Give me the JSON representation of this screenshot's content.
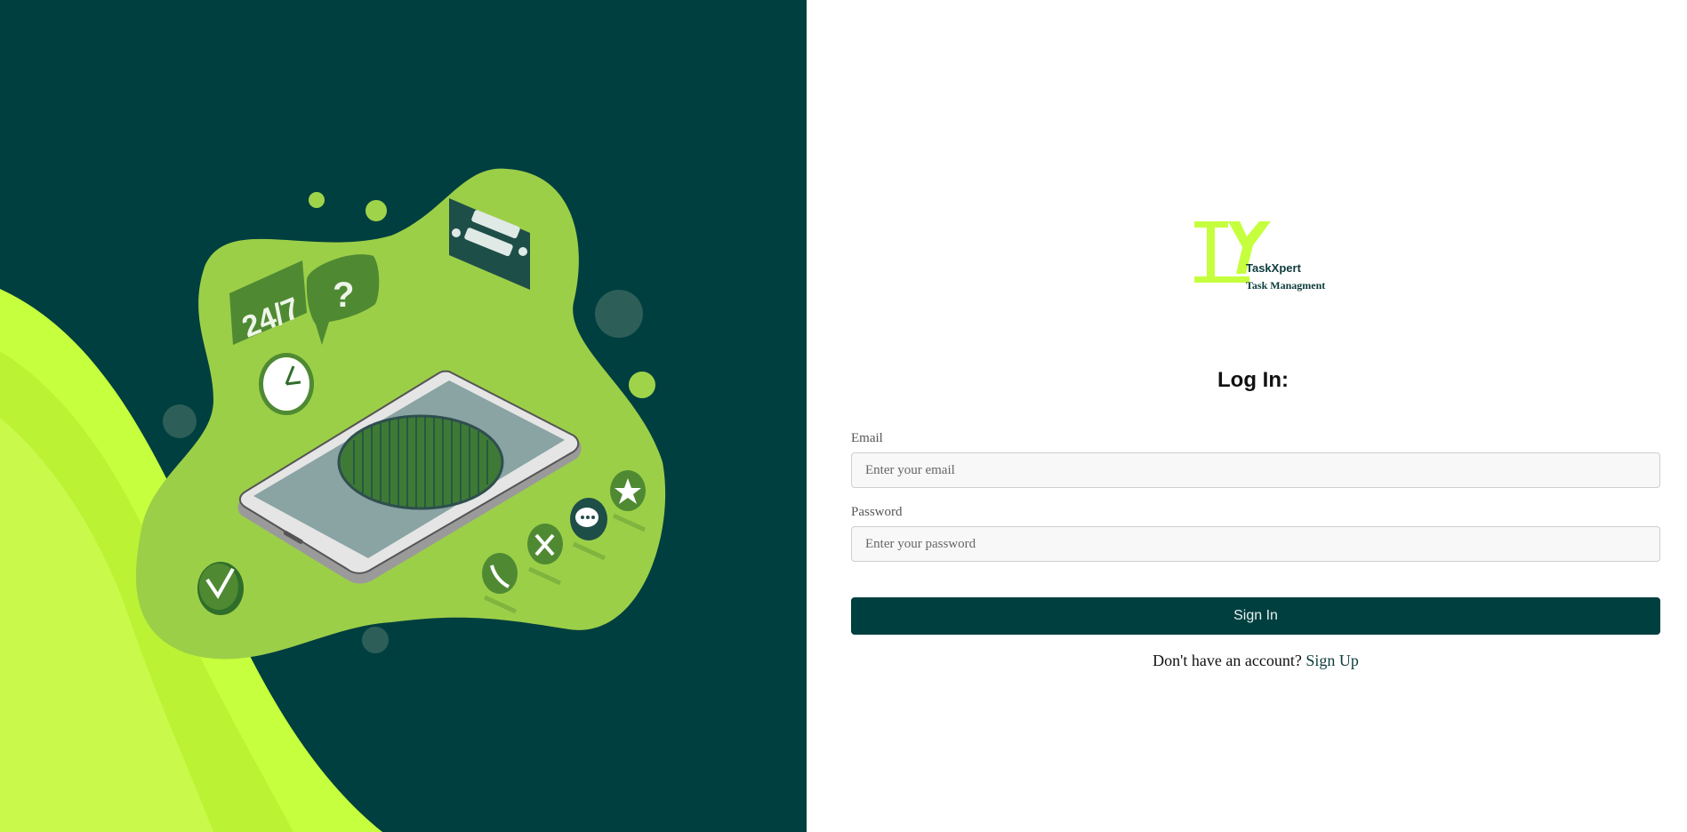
{
  "brand": {
    "name": "TaskXpert",
    "tagline": "Task Managment",
    "logo_mark": "TX",
    "accent_color": "#c6ff3d",
    "primary_color": "#003f3f"
  },
  "login": {
    "heading": "Log In:",
    "email_label": "Email",
    "email_placeholder": "Enter your email",
    "email_value": "",
    "password_label": "Password",
    "password_placeholder": "Enter your password",
    "password_value": "",
    "submit_label": "Sign In",
    "signup_prompt": "Don't have an account?",
    "signup_link": "Sign Up"
  },
  "illustration": {
    "badge_text": "24/7",
    "question_mark": "?"
  }
}
